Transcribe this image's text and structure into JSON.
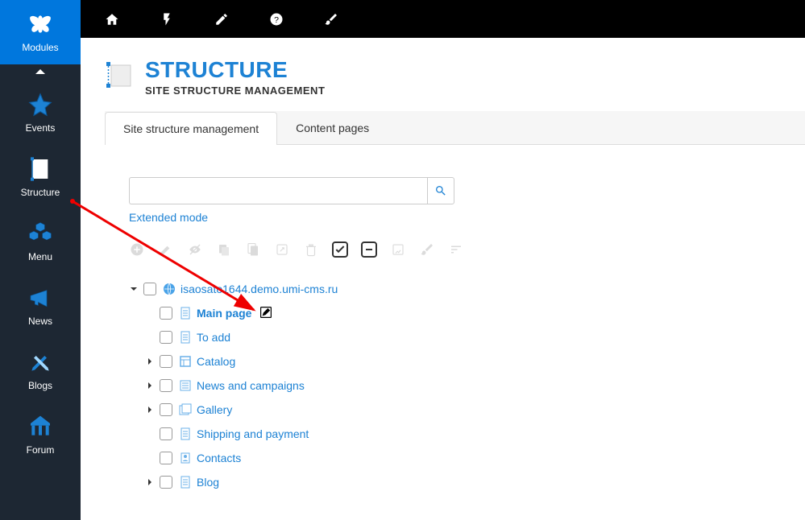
{
  "sidebar": {
    "modules_label": "Modules",
    "items": [
      {
        "label": "Events"
      },
      {
        "label": "Structure"
      },
      {
        "label": "Menu"
      },
      {
        "label": "News"
      },
      {
        "label": "Blogs"
      },
      {
        "label": "Forum"
      }
    ]
  },
  "header": {
    "title": "STRUCTURE",
    "subtitle": "SITE STRUCTURE MANAGEMENT"
  },
  "tabs": [
    {
      "label": "Site structure management",
      "active": true
    },
    {
      "label": "Content pages",
      "active": false
    }
  ],
  "search": {
    "placeholder": "",
    "extended_label": "Extended mode"
  },
  "tree": {
    "root": "isaosato1644.demo.umi-cms.ru",
    "items": [
      {
        "label": "Main page",
        "bold": true,
        "expandable": false,
        "has_edit": true,
        "icon": "page"
      },
      {
        "label": "To add",
        "expandable": false,
        "icon": "page"
      },
      {
        "label": "Catalog",
        "expandable": true,
        "icon": "catalog"
      },
      {
        "label": "News and campaigns",
        "expandable": true,
        "icon": "news"
      },
      {
        "label": "Gallery",
        "expandable": true,
        "icon": "gallery"
      },
      {
        "label": "Shipping and payment",
        "expandable": false,
        "icon": "page"
      },
      {
        "label": "Contacts",
        "expandable": false,
        "icon": "contacts"
      },
      {
        "label": "Blog",
        "expandable": true,
        "icon": "page"
      }
    ]
  },
  "colors": {
    "brand": "#1d82d4",
    "sidebar_bg": "#1d2733",
    "active_bg": "#0077dd"
  }
}
